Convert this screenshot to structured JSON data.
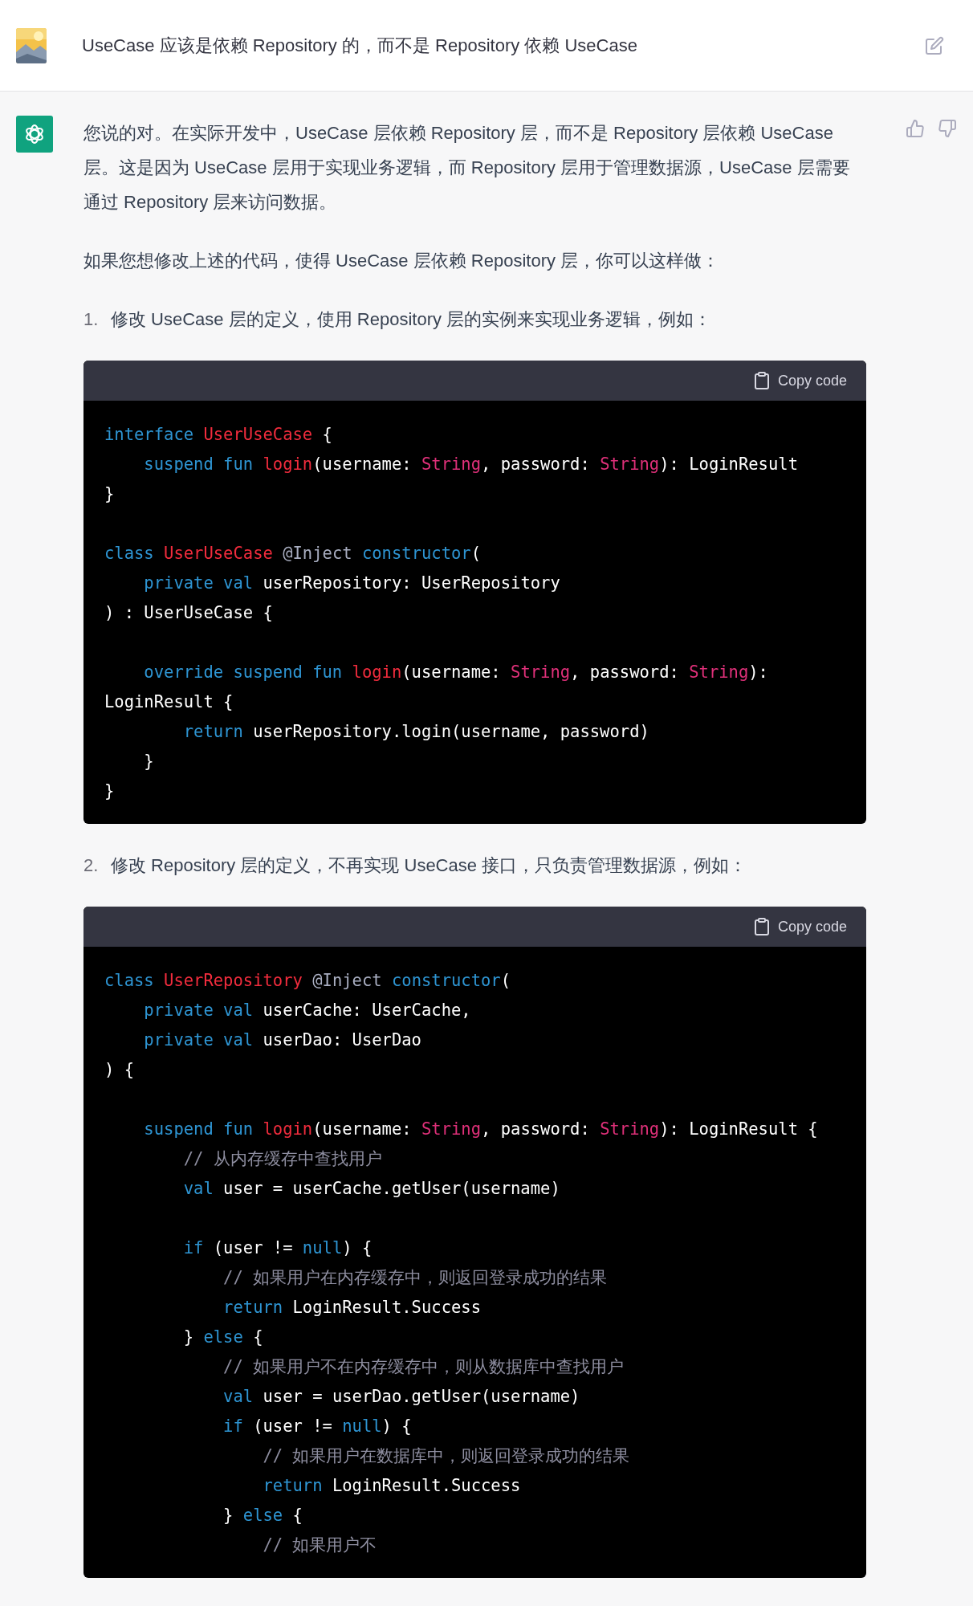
{
  "user_message": {
    "text": "UseCase 应该是依赖 Repository 的，而不是 Repository 依赖 UseCase"
  },
  "assistant_message": {
    "content": [
      {
        "kind": "paragraph",
        "text": "您说的对。在实际开发中，UseCase 层依赖 Repository 层，而不是 Repository 层依赖 UseCase 层。这是因为 UseCase 层用于实现业务逻辑，而 Repository 层用于管理数据源，UseCase 层需要通过 Repository 层来访问数据。"
      },
      {
        "kind": "paragraph",
        "text": "如果您想修改上述的代码，使得 UseCase 层依赖 Repository 层，你可以这样做："
      },
      {
        "kind": "step",
        "number": "1.",
        "text": "修改 UseCase 层的定义，使用 Repository 层的实例来实现业务逻辑，例如："
      },
      {
        "kind": "code",
        "copy_label": "Copy code",
        "lines": [
          [
            {
              "kind": "k",
              "text": "interface "
            },
            {
              "kind": "t",
              "text": "UserUseCase"
            },
            {
              "kind": "p",
              "text": " {"
            }
          ],
          [
            {
              "kind": "k",
              "text": "    suspend fun "
            },
            {
              "kind": "t",
              "text": "login"
            },
            {
              "kind": "p",
              "text": "(username: "
            },
            {
              "kind": "s",
              "text": "String"
            },
            {
              "kind": "p",
              "text": ", password: "
            },
            {
              "kind": "s",
              "text": "String"
            },
            {
              "kind": "p",
              "text": "): LoginResult"
            }
          ],
          [
            {
              "kind": "p",
              "text": "}"
            }
          ],
          [
            {
              "kind": "blank"
            }
          ],
          [
            {
              "kind": "k",
              "text": "class "
            },
            {
              "kind": "t",
              "text": "UserUseCase "
            },
            {
              "kind": "m",
              "text": "@Inject "
            },
            {
              "kind": "k",
              "text": "constructor"
            },
            {
              "kind": "p",
              "text": "("
            }
          ],
          [
            {
              "kind": "k",
              "text": "    private val "
            },
            {
              "kind": "p",
              "text": "userRepository: UserRepository"
            }
          ],
          [
            {
              "kind": "p",
              "text": ") : UserUseCase {"
            }
          ],
          [
            {
              "kind": "blank"
            }
          ],
          [
            {
              "kind": "k",
              "text": "    override suspend fun "
            },
            {
              "kind": "t",
              "text": "login"
            },
            {
              "kind": "p",
              "text": "(username: "
            },
            {
              "kind": "s",
              "text": "String"
            },
            {
              "kind": "p",
              "text": ", password: "
            },
            {
              "kind": "s",
              "text": "String"
            },
            {
              "kind": "p",
              "text": "):"
            }
          ],
          [
            {
              "kind": "p",
              "text": "LoginResult {"
            }
          ],
          [
            {
              "kind": "k",
              "text": "        return "
            },
            {
              "kind": "p",
              "text": "userRepository.login(username, password)"
            }
          ],
          [
            {
              "kind": "p",
              "text": "    }"
            }
          ],
          [
            {
              "kind": "p",
              "text": "}"
            }
          ]
        ]
      },
      {
        "kind": "step",
        "number": "2.",
        "text": "修改 Repository 层的定义，不再实现 UseCase 接口，只负责管理数据源，例如："
      },
      {
        "kind": "code",
        "copy_label": "Copy code",
        "lines": [
          [
            {
              "kind": "k",
              "text": "class "
            },
            {
              "kind": "t",
              "text": "UserRepository "
            },
            {
              "kind": "m",
              "text": "@Inject "
            },
            {
              "kind": "k",
              "text": "constructor"
            },
            {
              "kind": "p",
              "text": "("
            }
          ],
          [
            {
              "kind": "k",
              "text": "    private val "
            },
            {
              "kind": "p",
              "text": "userCache: UserCache,"
            }
          ],
          [
            {
              "kind": "k",
              "text": "    private val "
            },
            {
              "kind": "p",
              "text": "userDao: UserDao"
            }
          ],
          [
            {
              "kind": "p",
              "text": ") {"
            }
          ],
          [
            {
              "kind": "blank"
            }
          ],
          [
            {
              "kind": "k",
              "text": "    suspend fun "
            },
            {
              "kind": "t",
              "text": "login"
            },
            {
              "kind": "p",
              "text": "(username: "
            },
            {
              "kind": "s",
              "text": "String"
            },
            {
              "kind": "p",
              "text": ", password: "
            },
            {
              "kind": "s",
              "text": "String"
            },
            {
              "kind": "p",
              "text": "): LoginResult {"
            }
          ],
          [
            {
              "kind": "c",
              "text": "        // 从内存缓存中查找用户"
            }
          ],
          [
            {
              "kind": "k",
              "text": "        val "
            },
            {
              "kind": "p",
              "text": "user = userCache.getUser(username)"
            }
          ],
          [
            {
              "kind": "blank"
            }
          ],
          [
            {
              "kind": "k",
              "text": "        if "
            },
            {
              "kind": "p",
              "text": "(user != "
            },
            {
              "kind": "k",
              "text": "null"
            },
            {
              "kind": "p",
              "text": ") {"
            }
          ],
          [
            {
              "kind": "c",
              "text": "            // 如果用户在内存缓存中，则返回登录成功的结果"
            }
          ],
          [
            {
              "kind": "k",
              "text": "            return "
            },
            {
              "kind": "p",
              "text": "LoginResult.Success"
            }
          ],
          [
            {
              "kind": "p",
              "text": "        } "
            },
            {
              "kind": "k",
              "text": "else"
            },
            {
              "kind": "p",
              "text": " {"
            }
          ],
          [
            {
              "kind": "c",
              "text": "            // 如果用户不在内存缓存中，则从数据库中查找用户"
            }
          ],
          [
            {
              "kind": "k",
              "text": "            val "
            },
            {
              "kind": "p",
              "text": "user = userDao.getUser(username)"
            }
          ],
          [
            {
              "kind": "k",
              "text": "            if "
            },
            {
              "kind": "p",
              "text": "(user != "
            },
            {
              "kind": "k",
              "text": "null"
            },
            {
              "kind": "p",
              "text": ") {"
            }
          ],
          [
            {
              "kind": "c",
              "text": "                // 如果用户在数据库中，则返回登录成功的结果"
            }
          ],
          [
            {
              "kind": "k",
              "text": "                return "
            },
            {
              "kind": "p",
              "text": "LoginResult.Success"
            }
          ],
          [
            {
              "kind": "p",
              "text": "            } "
            },
            {
              "kind": "k",
              "text": "else"
            },
            {
              "kind": "p",
              "text": " {"
            }
          ],
          [
            {
              "kind": "c",
              "text": "                // 如果用户不"
            }
          ]
        ]
      }
    ]
  }
}
